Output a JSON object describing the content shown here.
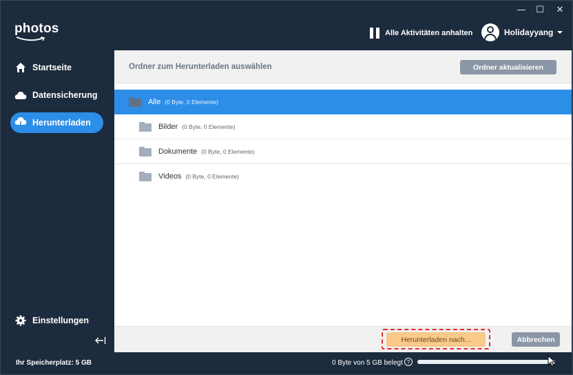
{
  "app": {
    "logo_text": "photos",
    "window_controls": {
      "minimize": "—",
      "maximize": "☐",
      "close": "✕"
    }
  },
  "header": {
    "pause_label": "Alle Aktivitäten anhalten",
    "username": "Holidayyang"
  },
  "sidebar": {
    "items": [
      {
        "label": "Startseite",
        "icon": "home-icon"
      },
      {
        "label": "Datensicherung",
        "icon": "cloud-icon"
      },
      {
        "label": "Herunterladen",
        "icon": "cloud-download-icon",
        "active": true
      }
    ],
    "settings_label": "Einstellungen"
  },
  "main": {
    "title": "Ordner zum Herunterladen auswählen",
    "refresh_label": "Ordner aktualisieren",
    "folders": [
      {
        "name": "Alle",
        "meta": "(0 Byte, 0 Elemente)",
        "selected": true
      },
      {
        "name": "Bilder",
        "meta": "(0 Byte, 0 Elemente)"
      },
      {
        "name": "Dokumente",
        "meta": "(0 Byte, 0 Elemente)"
      },
      {
        "name": "Videos",
        "meta": "(0 Byte, 0 Elemente)"
      }
    ],
    "download_label": "Herunterladen nach...",
    "cancel_label": "Abbrechen"
  },
  "status": {
    "storage_label": "Ihr Speicherplatz: 5 GB",
    "usage_label": "0 Byte von 5 GB belegt",
    "help": "?",
    "usage_fraction": 0
  },
  "colors": {
    "accent": "#2d8ee8",
    "sidebar_bg": "#1c2b3d",
    "download_button": "#f9c98a",
    "highlight": "#e32a2a"
  }
}
